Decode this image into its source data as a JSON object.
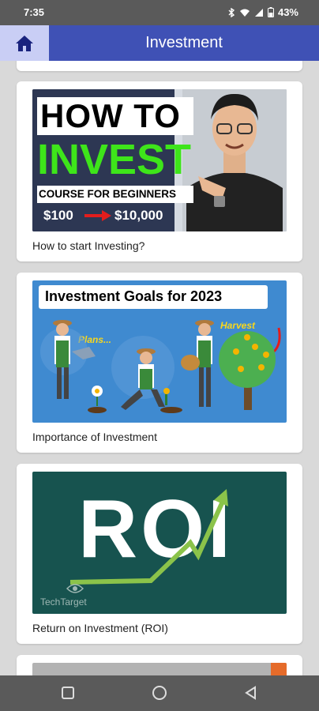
{
  "status_bar": {
    "time": "7:35",
    "battery": "43%",
    "icons": [
      "bluetooth-icon",
      "wifi-icon",
      "signal-icon",
      "battery-icon"
    ]
  },
  "app_bar": {
    "title": "Investment",
    "home_icon": "home-icon",
    "background_color": "#3f51b5"
  },
  "cards": [
    {
      "caption": "How to start Investing?",
      "thumbnail": {
        "line1": "HOW TO",
        "line2": "INVEST",
        "line3": "COURSE FOR BEGINNERS",
        "from": "$100",
        "to": "$10,000"
      }
    },
    {
      "caption": "Importance of Investment",
      "thumbnail": {
        "title": "Investment Goals for 2023",
        "label_plans": "Plans...",
        "label_harvest": "Harvest"
      }
    },
    {
      "caption": "Return on Investment (ROI)",
      "thumbnail": {
        "big_text": "ROI",
        "brand": "TechTarget"
      }
    }
  ],
  "nav": {
    "recent_icon": "square-icon",
    "home_icon": "circle-icon",
    "back_icon": "triangle-back-icon"
  }
}
